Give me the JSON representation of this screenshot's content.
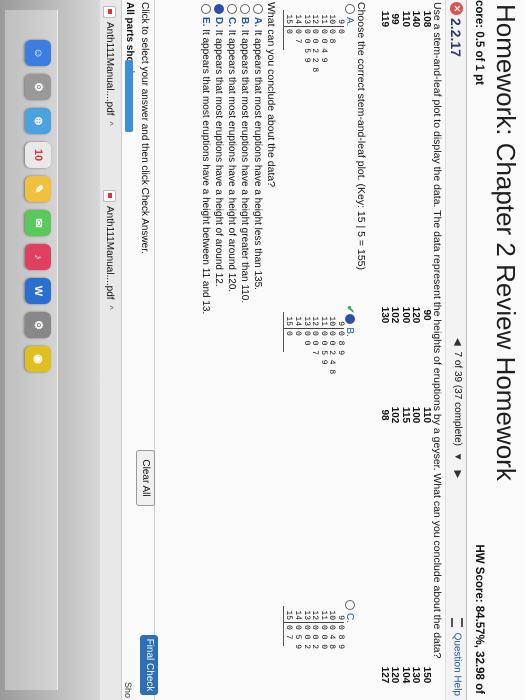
{
  "header": {
    "title": "Homework: Chapter 2 Review Homework",
    "score": "core: 0.5 of 1 pt",
    "hw_score": "HW Score: 84.57%, 32.98 of"
  },
  "question_bar": {
    "number": "2.2.17",
    "nav_text": "7 of 39 (37 complete)",
    "help": "Question Help"
  },
  "question": {
    "prompt": "Use a stem-and-leaf plot to display the data. The data represent the heights of eruptions by a geyser. What can you conclude about the data?",
    "data_columns": [
      [
        "108",
        "140",
        "110",
        "99",
        "119"
      ],
      [
        "90",
        "120",
        "100",
        "102",
        "130"
      ],
      [
        "110",
        "100",
        "115",
        "102",
        "98"
      ],
      [
        "150",
        "130",
        "104",
        "120",
        "127"
      ]
    ],
    "choose_text": "Choose the correct stem-and-leaf plot. (Key: 15 | 5 = 155)",
    "plots": [
      {
        "label": "A.",
        "rows": [
          [
            "9",
            "0"
          ],
          [
            "10",
            "0 8"
          ],
          [
            "11",
            "0 0 4 9"
          ],
          [
            "12",
            "0 0 2 2 8"
          ],
          [
            "13",
            "0 0 5 9"
          ],
          [
            "14",
            "0 7"
          ],
          [
            "15",
            "0"
          ]
        ]
      },
      {
        "label": "B.",
        "rows": [
          [
            "9",
            "0 8 9"
          ],
          [
            "10",
            "0 0 2 4 8"
          ],
          [
            "11",
            "0 0 5 9"
          ],
          [
            "12",
            "0 0 7"
          ],
          [
            "13",
            "0 0"
          ],
          [
            "14",
            "0"
          ],
          [
            "15",
            "0"
          ]
        ]
      },
      {
        "label": "C.",
        "rows": [
          [
            "9",
            "0 8 9"
          ],
          [
            "10",
            "0 4 8"
          ],
          [
            "11",
            "0 0 0"
          ],
          [
            "12",
            "0 0 2"
          ],
          [
            "13",
            "0 0 2"
          ],
          [
            "14",
            "0 5 9"
          ],
          [
            "15",
            "0 7"
          ]
        ]
      }
    ],
    "conclude_text": "What can you conclude about the data?",
    "answers": [
      {
        "letter": "A.",
        "text": "It appears that most eruptions have a height less than 135."
      },
      {
        "letter": "B.",
        "text": "It appears that most eruptions have a height greater than 110."
      },
      {
        "letter": "C.",
        "text": "It appears that most eruptions have a height of around 120."
      },
      {
        "letter": "D.",
        "text": "It appears that most eruptions have a height of around 12."
      },
      {
        "letter": "E.",
        "text": "It appears that most eruptions have a height between 11 and 13."
      }
    ],
    "selected_answer": "D."
  },
  "footer": {
    "click_msg": "Click to select your answer and then click Check Answer.",
    "parts": "All parts showing",
    "progress_fraction": 1.0,
    "clear_all": "Clear All",
    "final_check": "Final Check",
    "shortcut": "Sho"
  },
  "downloads": [
    {
      "name": "Anth111Manual....pdf"
    },
    {
      "name": "Anth111Manual....pdf"
    }
  ],
  "dock": {
    "calendar_day": "10"
  }
}
